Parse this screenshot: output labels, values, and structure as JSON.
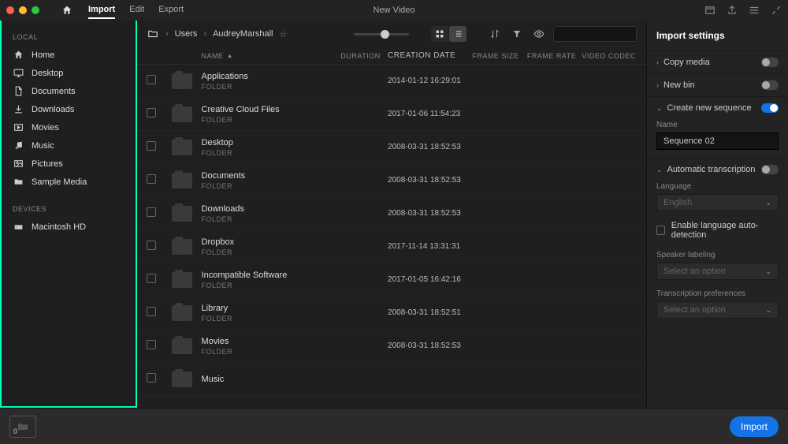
{
  "window_title": "New Video",
  "tabs": {
    "import": "Import",
    "edit": "Edit",
    "export": "Export"
  },
  "sidebar": {
    "local_header": "LOCAL",
    "devices_header": "DEVICES",
    "local": [
      {
        "icon": "home",
        "label": "Home"
      },
      {
        "icon": "monitor",
        "label": "Desktop"
      },
      {
        "icon": "doc",
        "label": "Documents"
      },
      {
        "icon": "download",
        "label": "Downloads"
      },
      {
        "icon": "film",
        "label": "Movies"
      },
      {
        "icon": "music",
        "label": "Music"
      },
      {
        "icon": "image",
        "label": "Pictures"
      },
      {
        "icon": "folder",
        "label": "Sample Media"
      }
    ],
    "devices": [
      {
        "icon": "drive",
        "label": "Macintosh HD"
      }
    ]
  },
  "breadcrumb": [
    "Users",
    "AudreyMarshall"
  ],
  "columns": {
    "name": "NAME",
    "duration": "DURATION",
    "creation": "CREATION DATE",
    "framesize": "FRAME SIZE",
    "framerate": "FRAME RATE",
    "codec": "VIDEO CODEC"
  },
  "rows": [
    {
      "name": "Applications",
      "type": "FOLDER",
      "date": "2014-01-12 16:29:01"
    },
    {
      "name": "Creative Cloud Files",
      "type": "FOLDER",
      "date": "2017-01-06 11:54:23"
    },
    {
      "name": "Desktop",
      "type": "FOLDER",
      "date": "2008-03-31 18:52:53"
    },
    {
      "name": "Documents",
      "type": "FOLDER",
      "date": "2008-03-31 18:52:53"
    },
    {
      "name": "Downloads",
      "type": "FOLDER",
      "date": "2008-03-31 18:52:53"
    },
    {
      "name": "Dropbox",
      "type": "FOLDER",
      "date": "2017-11-14 13:31:31"
    },
    {
      "name": "Incompatible Software",
      "type": "FOLDER",
      "date": "2017-01-05 16:42:16"
    },
    {
      "name": "Library",
      "type": "FOLDER",
      "date": "2008-03-31 18:52:51"
    },
    {
      "name": "Movies",
      "type": "FOLDER",
      "date": "2008-03-31 18:52:53"
    },
    {
      "name": "Music",
      "type": "",
      "date": ""
    }
  ],
  "rightpanel": {
    "title": "Import settings",
    "copy_media": "Copy media",
    "new_bin": "New bin",
    "create_seq": "Create new sequence",
    "name_label": "Name",
    "name_value": "Sequence 02",
    "auto_trans": "Automatic transcription",
    "language_label": "Language",
    "language_value": "English",
    "autodetect": "Enable language auto-detection",
    "speaker_label": "Speaker labeling",
    "speaker_value": "Select an option",
    "transpref_label": "Transcription preferences",
    "transpref_value": "Select an option"
  },
  "bottombar": {
    "count": "0",
    "import_btn": "Import"
  }
}
